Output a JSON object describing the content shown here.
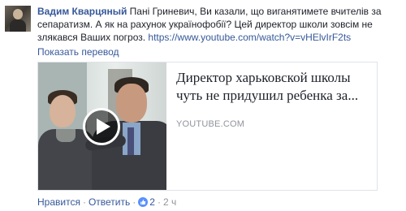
{
  "comment": {
    "author": "Вадим Кварцяный",
    "text": " Пані Гриневич, Ви казали, що виганятимете вчителів за сепаратизм. А як на рахунок українофобії? Цей директор школи зовсім не злякався Ваших погроз. ",
    "link": "https://www.youtube.com/watch?v=vHElvIrF2ts",
    "translate_label": "Показать перевод"
  },
  "preview": {
    "title": "Директор харьковской школы чуть не придушил ребенка за...",
    "domain": "YOUTUBE.COM",
    "play_icon": "play-icon"
  },
  "actions": {
    "like_label": "Нравится",
    "dot": "·",
    "reply_label": "Ответить",
    "like_count": "2",
    "time": "2 ч"
  },
  "colors": {
    "link": "#365899",
    "meta": "#90949c",
    "text": "#1d2129"
  }
}
